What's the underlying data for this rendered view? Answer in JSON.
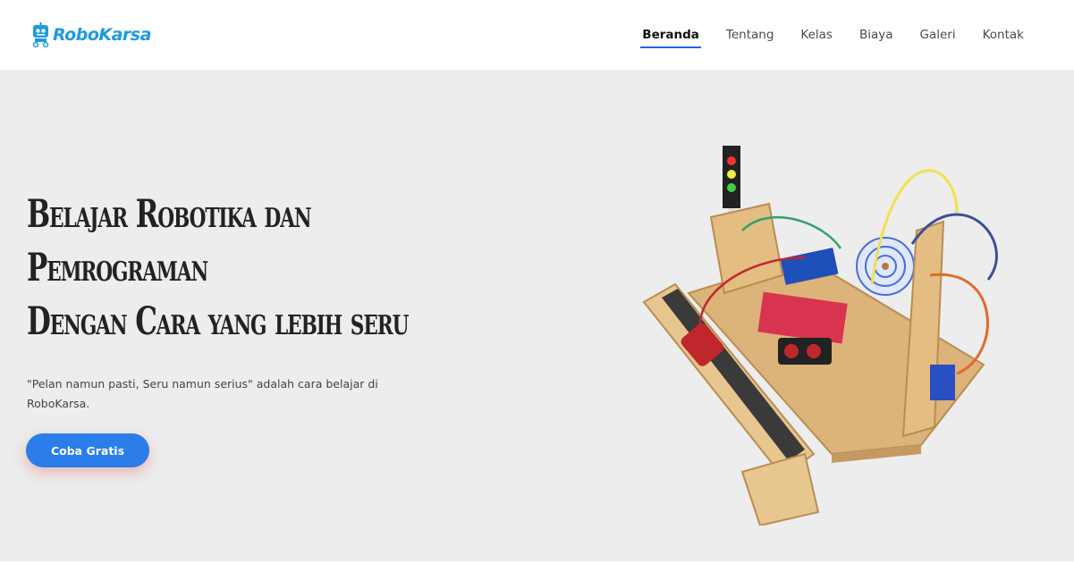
{
  "brand": {
    "name": "RoboKarsa"
  },
  "nav": {
    "items": [
      {
        "label": "Beranda",
        "active": true
      },
      {
        "label": "Tentang",
        "active": false
      },
      {
        "label": "Kelas",
        "active": false
      },
      {
        "label": "Biaya",
        "active": false
      },
      {
        "label": "Galeri",
        "active": false
      },
      {
        "label": "Kontak",
        "active": false
      }
    ]
  },
  "hero": {
    "headline_lines": [
      "Belajar Robotika dan",
      "Pemrograman",
      "Dengan Cara yang lebih seru"
    ],
    "tagline": "\"Pelan namun pasti, Seru namun serius\" adalah cara belajar di RoboKarsa.",
    "cta_label": "Coba Gratis"
  },
  "colors": {
    "accent": "#2b7de9",
    "brand": "#1e9be0",
    "hero_bg": "#ededed"
  }
}
